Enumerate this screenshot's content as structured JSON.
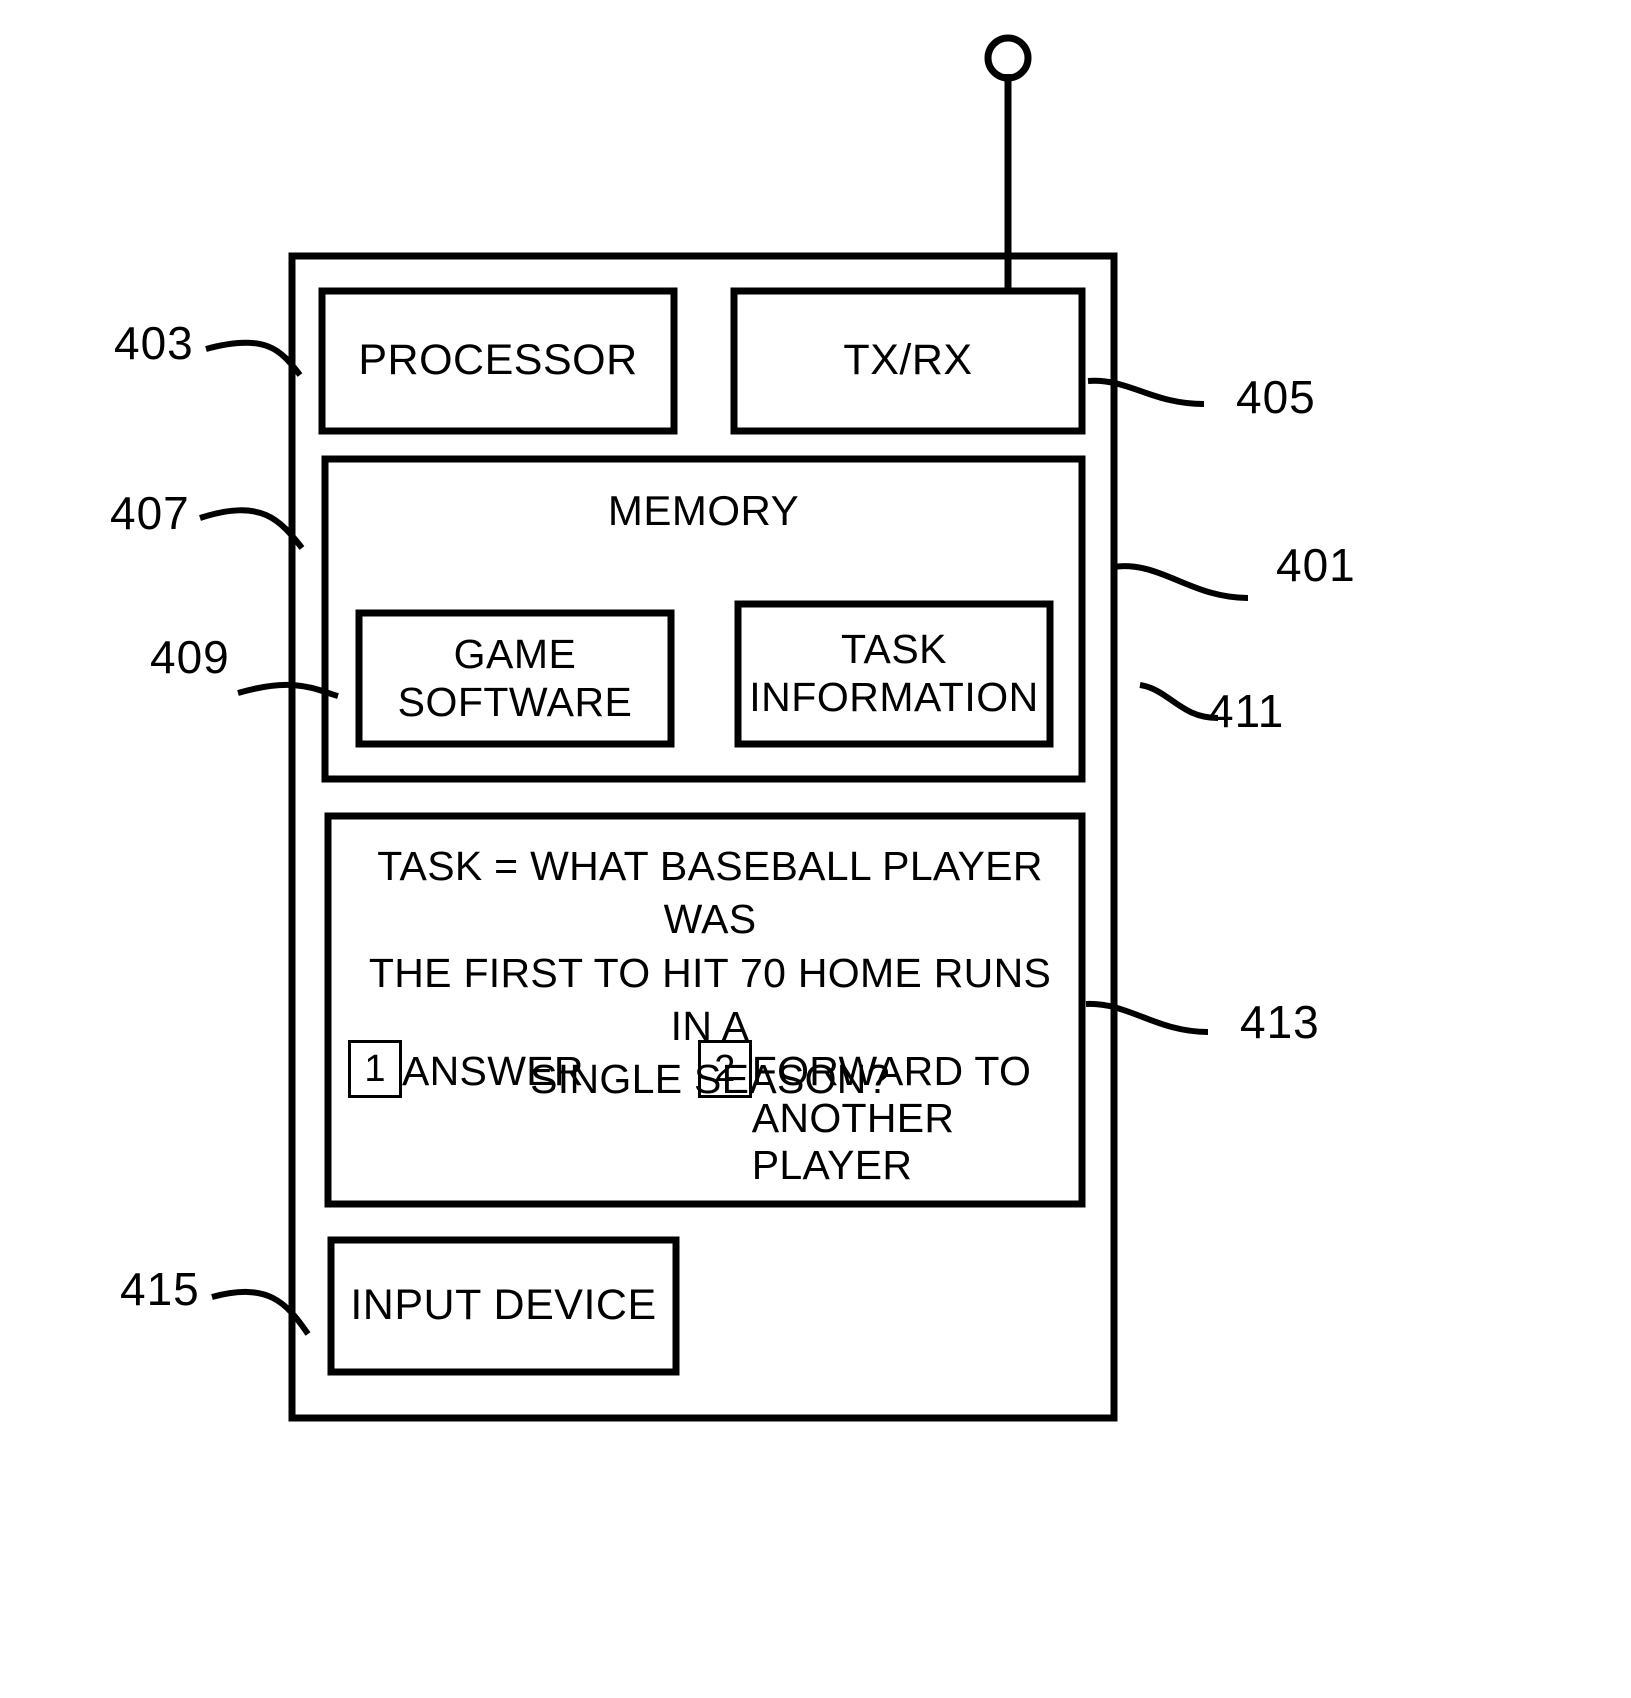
{
  "figure": {
    "type": "patent-block-diagram",
    "background_color": "#ffffff",
    "line_color": "#000000",
    "device": {
      "ref": "401",
      "antenna": {
        "ref_line": "405"
      }
    },
    "blocks": [
      {
        "id": "processor",
        "label": "PROCESSOR",
        "ref": "403"
      },
      {
        "id": "txrx",
        "label": "TX/RX",
        "ref": "405"
      },
      {
        "id": "memory",
        "label": "MEMORY",
        "ref": "407"
      },
      {
        "id": "game_software",
        "label": "GAME\nSOFTWARE",
        "ref": "409"
      },
      {
        "id": "task_information",
        "label": "TASK\nINFORMATION",
        "ref": "411"
      },
      {
        "id": "display",
        "label": "",
        "ref": "413"
      },
      {
        "id": "input_device",
        "label": "INPUT DEVICE",
        "ref": "415"
      }
    ],
    "display": {
      "ref": "413",
      "task_text": "TASK = WHAT BASEBALL PLAYER WAS THE FIRST TO HIT 70 HOME RUNS IN A SINGLE SEASON?",
      "task_lines": [
        "TASK = WHAT BASEBALL PLAYER WAS",
        "THE FIRST TO HIT 70 HOME RUNS IN A",
        "SINGLE SEASON?"
      ],
      "options": [
        {
          "number": "1",
          "label": "ANSWER"
        },
        {
          "number": "2",
          "label": "FORWARD TO\nANOTHER PLAYER"
        }
      ]
    },
    "reference_numerals": {
      "r401": "401",
      "r403": "403",
      "r405": "405",
      "r407": "407",
      "r409": "409",
      "r411": "411",
      "r413": "413",
      "r415": "415"
    }
  }
}
